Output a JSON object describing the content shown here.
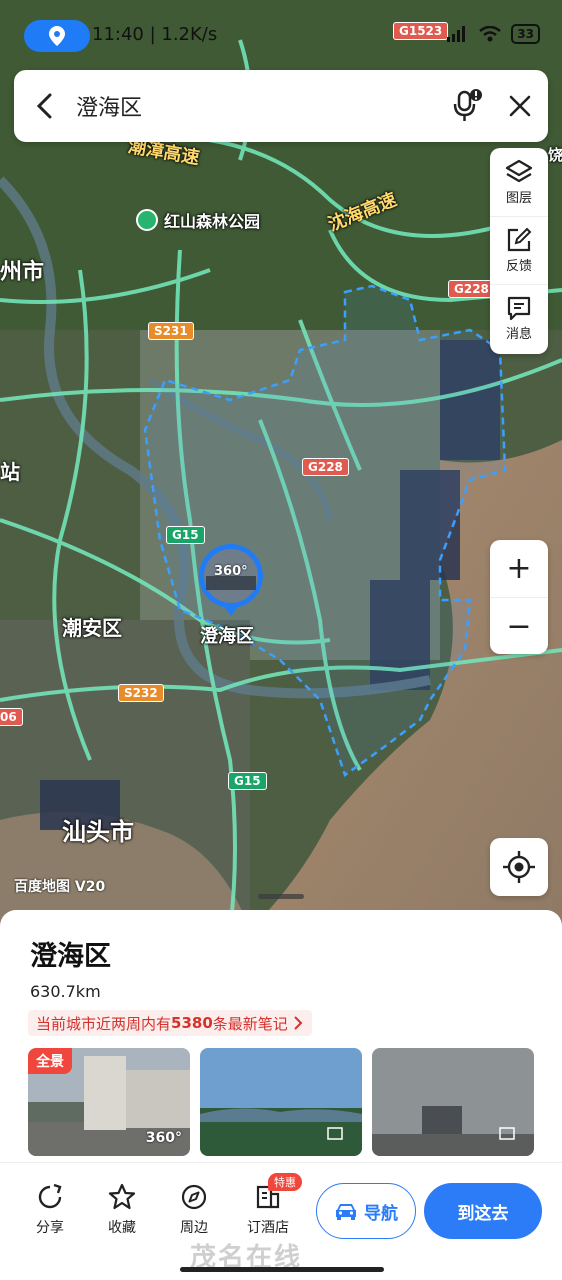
{
  "status_bar": {
    "time_speed": "11:40 | 1.2K/s",
    "battery": "33"
  },
  "search": {
    "query": "澄海区"
  },
  "tools": {
    "layers_label": "图层",
    "feedback_label": "反馈",
    "messages_label": "消息"
  },
  "zoom": {
    "in_label": "+",
    "out_label": "−"
  },
  "map": {
    "labels": {
      "expressway_chaozhang": "潮漳高速",
      "expressway_shenhai": "沈海高速",
      "park": "红山森林公园",
      "city_left": "州市",
      "station": "站",
      "chaoan": "潮安区",
      "chenghai": "澄海区",
      "shantou": "汕头市",
      "edge_right": "饶",
      "edge_left_shield": "06"
    },
    "shields": {
      "g1523": "G1523",
      "g228_top": "G228",
      "g228_mid": "G228",
      "s231": "S231",
      "g15_a": "G15",
      "g15_b": "G15",
      "s232": "S232"
    },
    "panorama_label": "360°",
    "watermark": "百度地图 V20"
  },
  "place": {
    "name": "澄海区",
    "distance": "630.7km",
    "notes_prefix": "当前城市近两周内有",
    "notes_count": "5380",
    "notes_suffix": "条最新笔记"
  },
  "photos": {
    "panorama_tag": "全景",
    "panorama_badge": "360°"
  },
  "actions": {
    "share": "分享",
    "favorite": "收藏",
    "nearby": "周边",
    "hotel": "订酒店",
    "hotel_badge": "特惠",
    "navigate": "导航",
    "go_there": "到这去"
  },
  "footer_mark": "茂名在线"
}
